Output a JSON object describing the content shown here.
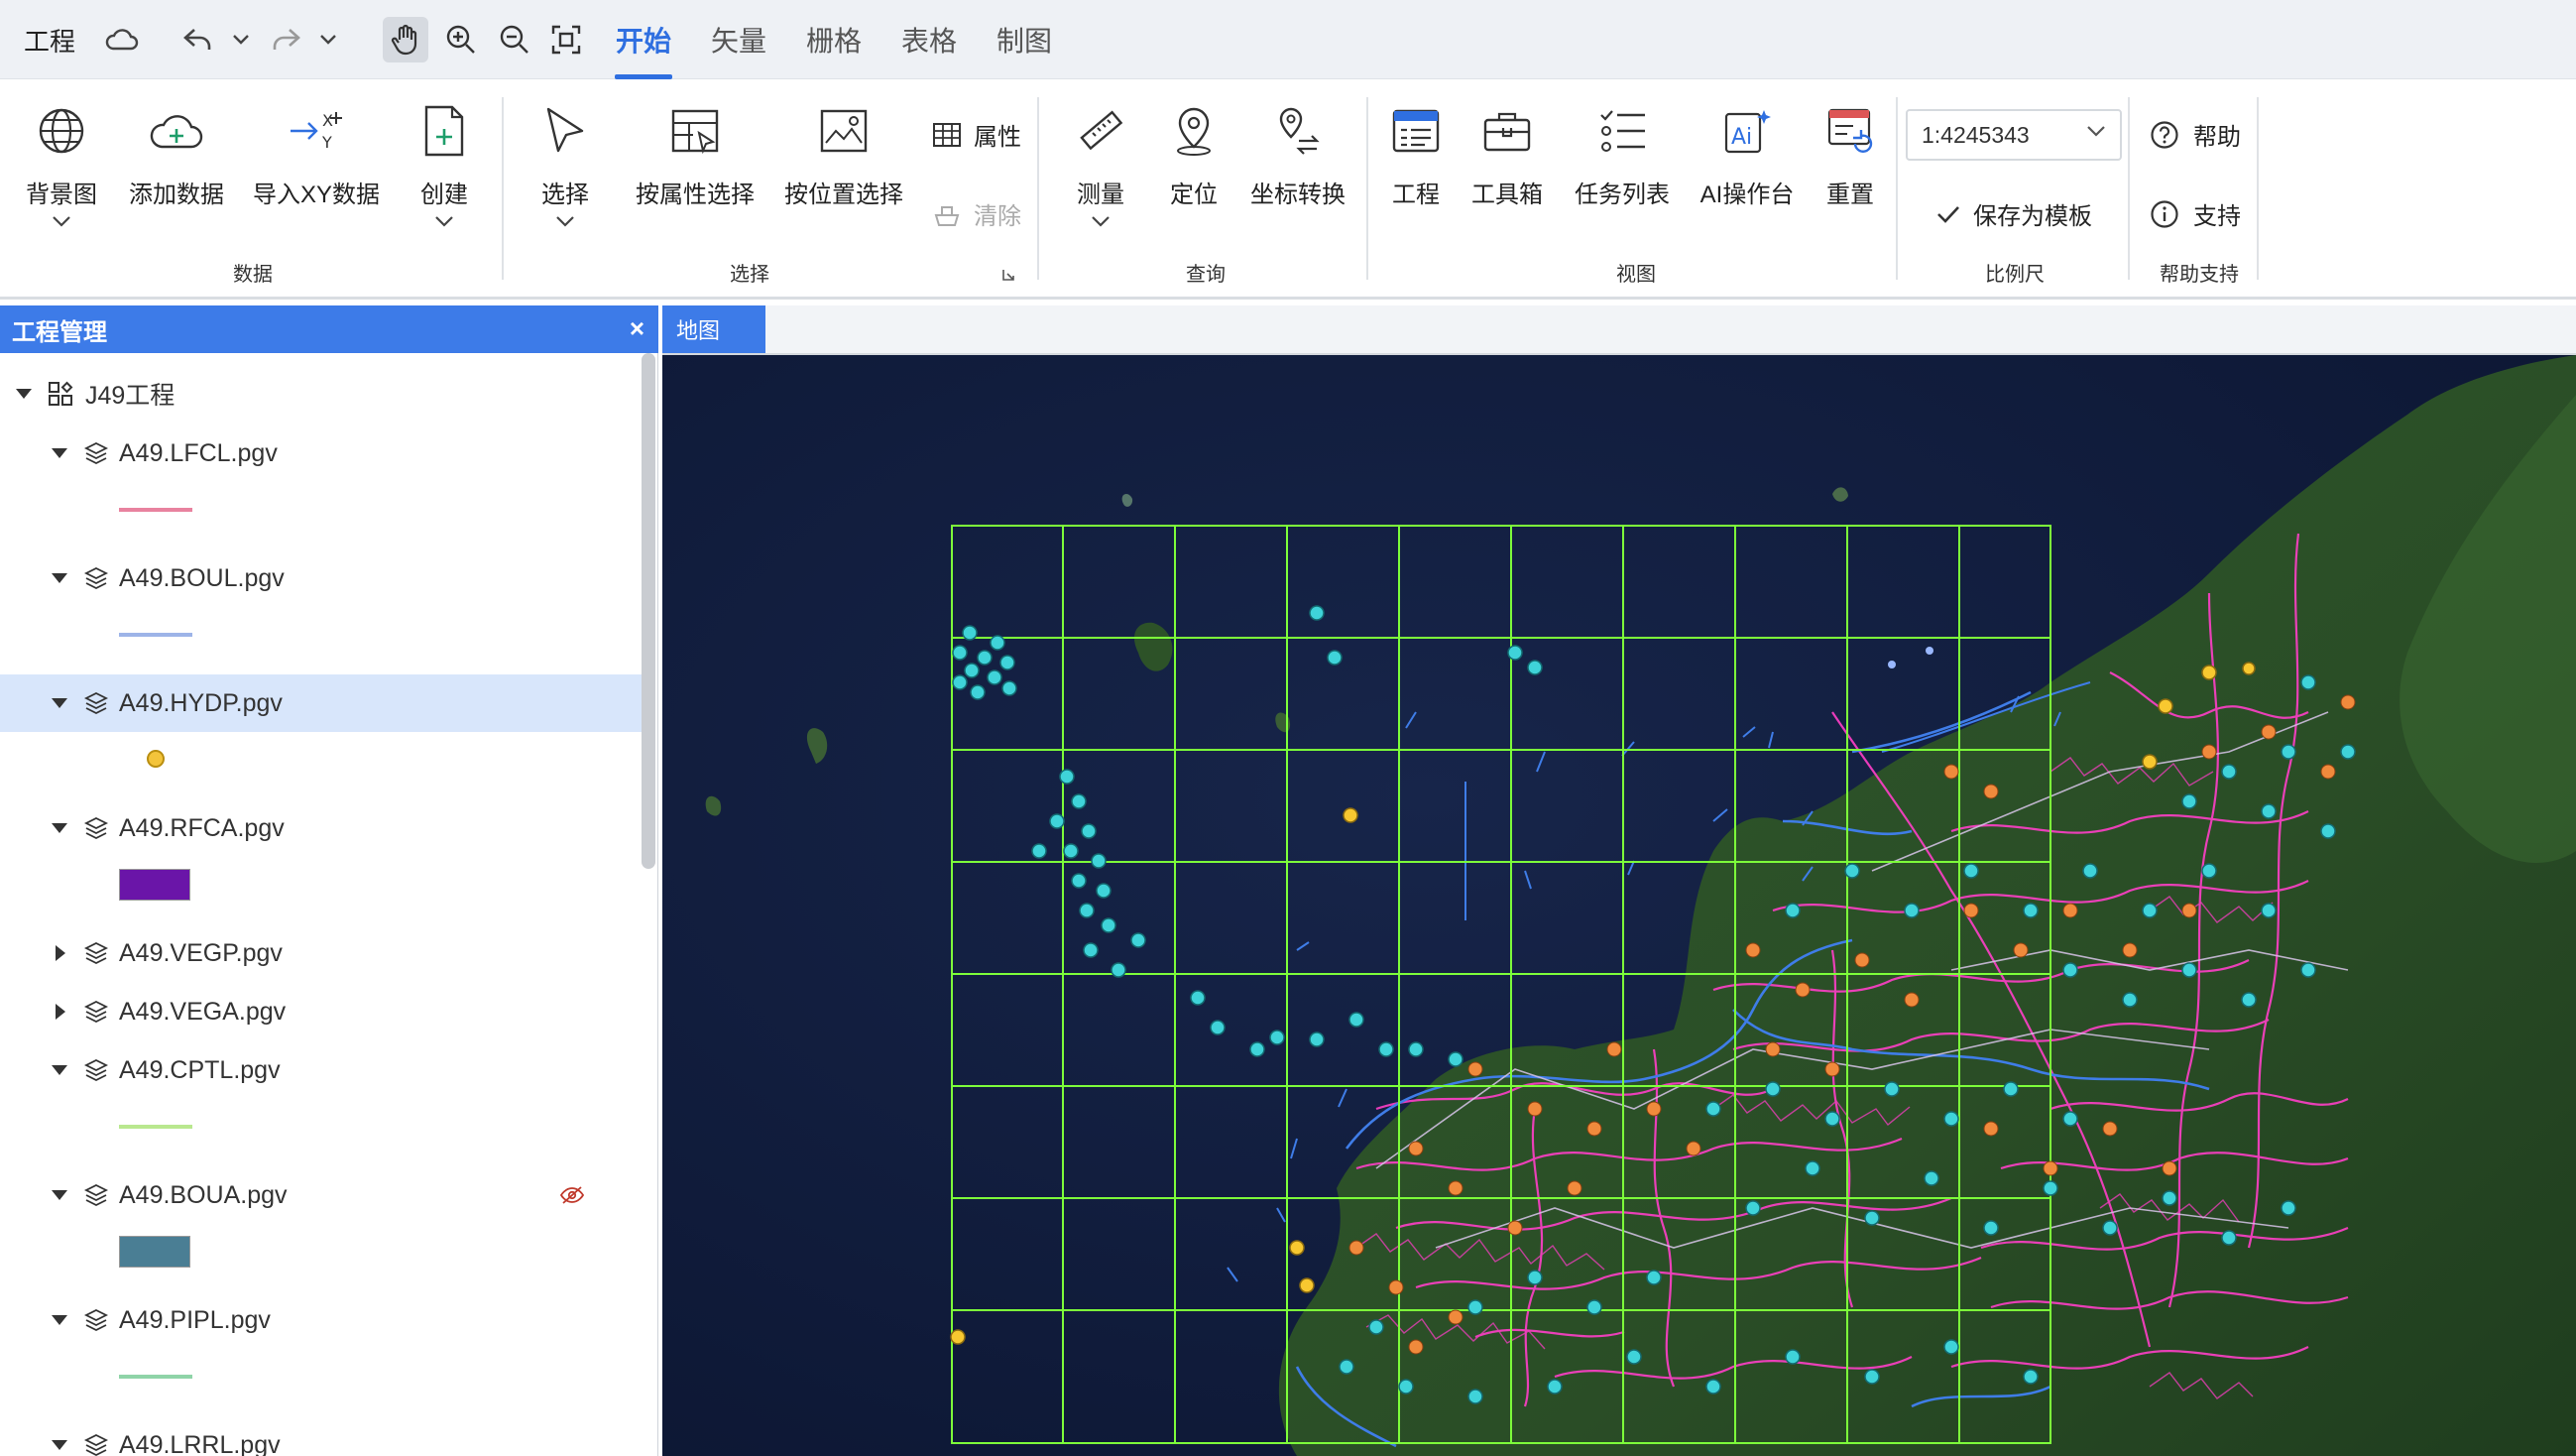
{
  "menubar": {
    "project_label": "工程",
    "tabs": [
      {
        "label": "开始",
        "active": true
      },
      {
        "label": "矢量",
        "active": false
      },
      {
        "label": "栅格",
        "active": false
      },
      {
        "label": "表格",
        "active": false
      },
      {
        "label": "制图",
        "active": false
      }
    ]
  },
  "ribbon": {
    "data_group": {
      "label": "数据",
      "basemap": "背景图",
      "add_data": "添加数据",
      "import_xy": "导入XY数据",
      "create": "创建"
    },
    "select_group": {
      "label": "选择",
      "select": "选择",
      "select_by_attr": "按属性选择",
      "select_by_location": "按位置选择",
      "attributes": "属性",
      "clear": "清除"
    },
    "query_group": {
      "label": "查询",
      "measure": "测量",
      "locate": "定位",
      "coord_convert": "坐标转换"
    },
    "view_group": {
      "label": "视图",
      "project": "工程",
      "toolbox": "工具箱",
      "task_list": "任务列表",
      "ai_console": "AI操作台",
      "reset": "重置"
    },
    "scale_group": {
      "label": "比例尺",
      "scale_value": "1:4245343",
      "save_template": "保存为模板"
    },
    "help_group": {
      "label": "帮助支持",
      "help": "帮助",
      "support": "支持"
    }
  },
  "panel": {
    "title": "工程管理",
    "close_glyph": "×",
    "root": "J49工程",
    "layers": [
      {
        "name": "A49.LFCL.pgv",
        "expanded": true,
        "legend": "line",
        "color": "#e8829f"
      },
      {
        "name": "A49.BOUL.pgv",
        "expanded": true,
        "legend": "line",
        "color": "#9db4e8"
      },
      {
        "name": "A49.HYDP.pgv",
        "expanded": true,
        "legend": "dot",
        "color": "#f3c43b",
        "selected": true
      },
      {
        "name": "A49.RFCA.pgv",
        "expanded": true,
        "legend": "rect",
        "color": "#6a15a8"
      },
      {
        "name": "A49.VEGP.pgv",
        "expanded": false
      },
      {
        "name": "A49.VEGA.pgv",
        "expanded": false
      },
      {
        "name": "A49.CPTL.pgv",
        "expanded": true,
        "legend": "line",
        "color": "#b9e88f"
      },
      {
        "name": "A49.BOUA.pgv",
        "expanded": true,
        "legend": "rect",
        "color": "#4a7e94",
        "hidden_icon": true
      },
      {
        "name": "A49.PIPL.pgv",
        "expanded": true,
        "legend": "line",
        "color": "#8fd4a8"
      },
      {
        "name": "A49.LRRL.pgv",
        "expanded": true
      }
    ]
  },
  "map": {
    "tab_label": "地图"
  },
  "colors": {
    "accent": "#2f6fe0",
    "panel_header": "#3d7be8",
    "grid": "#7dff3a",
    "river": "#ff3fc8",
    "point_cyan": "#3fd3d9",
    "point_orange": "#f08a3c",
    "point_yellow": "#f8c830"
  }
}
